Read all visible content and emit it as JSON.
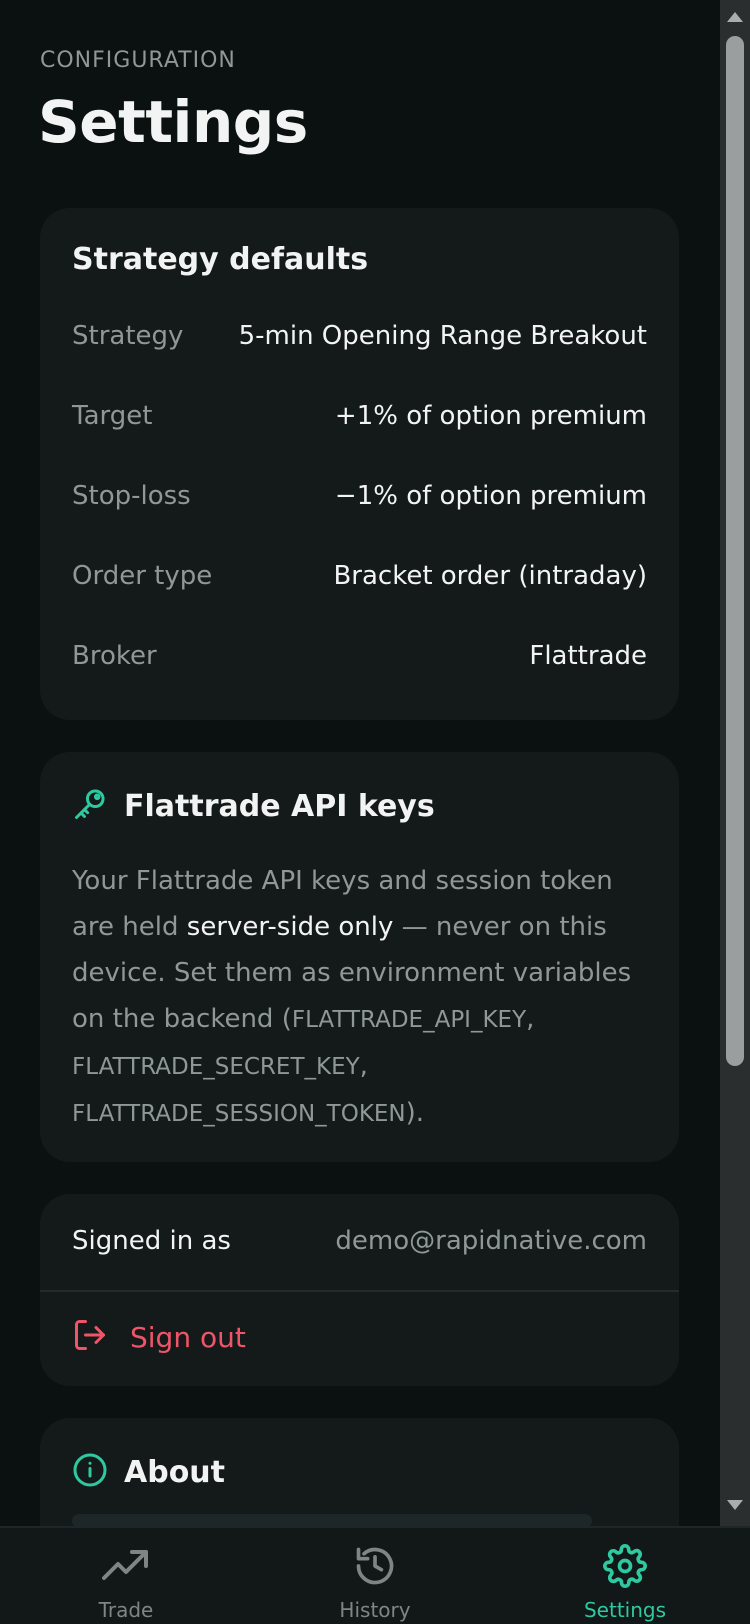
{
  "header": {
    "eyebrow": "CONFIGURATION",
    "title": "Settings"
  },
  "strategy_card": {
    "title": "Strategy defaults",
    "rows": [
      {
        "label": "Strategy",
        "value": "5-min Opening Range Breakout"
      },
      {
        "label": "Target",
        "value": "+1% of option premium"
      },
      {
        "label": "Stop-loss",
        "value": "−1% of option premium"
      },
      {
        "label": "Order type",
        "value": "Bracket order (intraday)"
      },
      {
        "label": "Broker",
        "value": "Flattrade"
      }
    ]
  },
  "keys_card": {
    "icon": "key-icon",
    "title": "Flattrade API keys",
    "text_1": "Your Flattrade API keys and session token are held ",
    "text_highlight": "server-side only",
    "text_2": " — never on this device. Set them as environment variables on the backend (",
    "env_1": "FLATTRADE_API_KEY",
    "sep_1": ", ",
    "env_2": "FLATTRADE_SECRET_KEY",
    "sep_2": ", ",
    "env_3": "FLATTRADE_SESSION_TOKEN",
    "text_end": ")."
  },
  "account_card": {
    "signed_in_label": "Signed in as",
    "email": "demo@rapidnative.com",
    "signout_icon": "sign-out-icon",
    "signout_label": "Sign out"
  },
  "about_card": {
    "icon": "info-icon",
    "title": "About"
  },
  "bottom_nav": {
    "active": "Settings",
    "items": [
      {
        "label": "Trade",
        "icon": "trending-up-icon"
      },
      {
        "label": "History",
        "icon": "history-icon"
      },
      {
        "label": "Settings",
        "icon": "gear-icon"
      }
    ]
  },
  "colors": {
    "background": "#0b1010",
    "card": "#141a1a",
    "accent": "#2ec9a0",
    "danger": "#f05468",
    "text_primary": "#f2f4f3",
    "text_muted": "#8f9895"
  }
}
